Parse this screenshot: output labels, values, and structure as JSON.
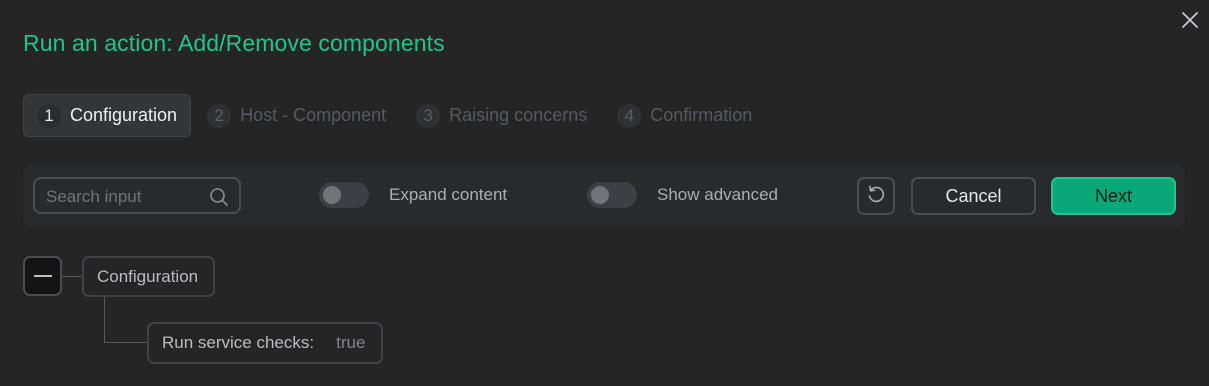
{
  "dialog": {
    "title": "Run an action: Add/Remove components"
  },
  "steps": [
    {
      "num": "1",
      "label": "Configuration",
      "active": true
    },
    {
      "num": "2",
      "label": "Host - Component",
      "active": false
    },
    {
      "num": "3",
      "label": "Raising concerns",
      "active": false
    },
    {
      "num": "4",
      "label": "Confirmation",
      "active": false
    }
  ],
  "toolbar": {
    "search_placeholder": "Search input",
    "expand_label": "Expand content",
    "advanced_label": "Show advanced",
    "cancel_label": "Cancel",
    "next_label": "Next"
  },
  "tree": {
    "root_label": "Configuration",
    "field_label": "Run service checks:",
    "field_value": "true"
  },
  "colors": {
    "accent": "#1ec58f",
    "primary_button": "#0aa878",
    "background": "#252525"
  }
}
